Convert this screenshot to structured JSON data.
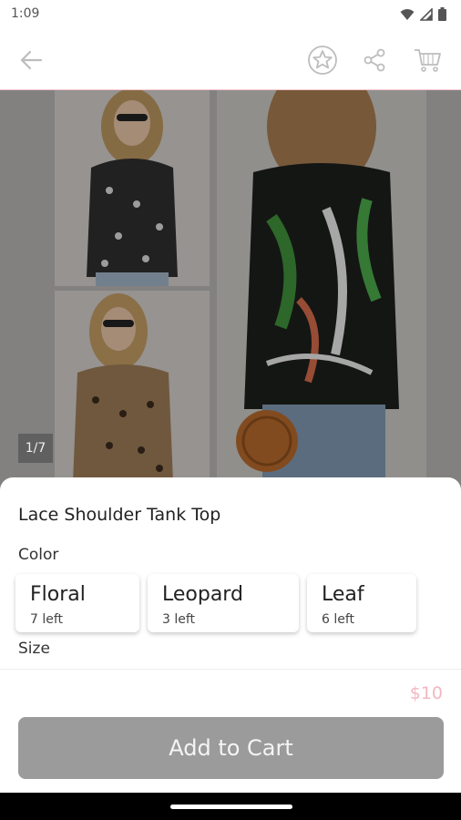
{
  "status_bar": {
    "time": "1:09"
  },
  "gallery": {
    "counter": "1/7"
  },
  "product": {
    "title": "Lace Shoulder Tank Top",
    "price": "$10"
  },
  "color_section": {
    "label": "Color",
    "options": [
      {
        "name": "Floral",
        "stock": "7 left"
      },
      {
        "name": "Leopard",
        "stock": "3 left"
      },
      {
        "name": "Leaf",
        "stock": "6 left"
      }
    ]
  },
  "size_section": {
    "label": "Size"
  },
  "cart": {
    "button_label": "Add to Cart"
  },
  "colors": {
    "accent_pink": "#f4b6c1",
    "button_gray": "#9b9b9b"
  }
}
